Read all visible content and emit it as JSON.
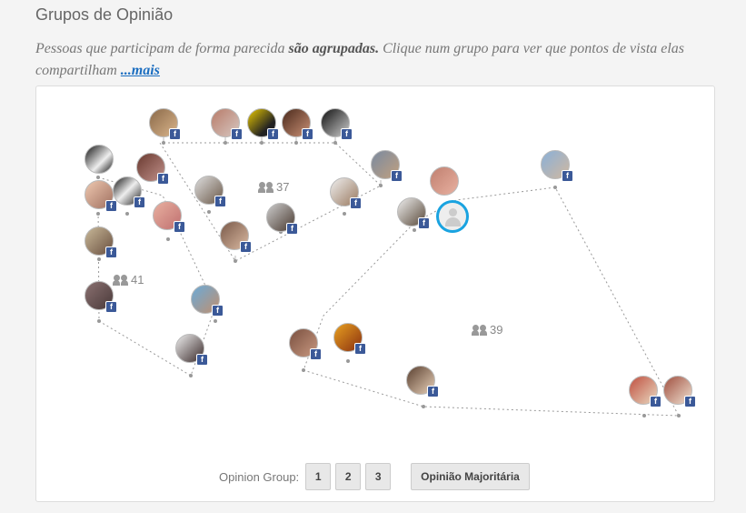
{
  "header": {
    "title": "Grupos de Opinião",
    "subtitle_pre": "Pessoas que participam de forma parecida ",
    "subtitle_bold": "são agrupadas.",
    "subtitle_post": " Clique num grupo para ver que pontos de vista elas compartilham ",
    "more_link": "...mais"
  },
  "groups": [
    {
      "count": "37"
    },
    {
      "count": "41"
    },
    {
      "count": "39"
    }
  ],
  "controls": {
    "label": "Opinion Group:",
    "buttons": [
      "1",
      "2",
      "3"
    ],
    "majority": "Opinião Majoritária"
  },
  "colors": {
    "accent": "#1aa3e0",
    "facebook": "#3b5998",
    "hull": "#999999"
  },
  "icons": {
    "facebook": "facebook-badge-icon",
    "group": "group-icon",
    "self": "user-placeholder-icon"
  }
}
